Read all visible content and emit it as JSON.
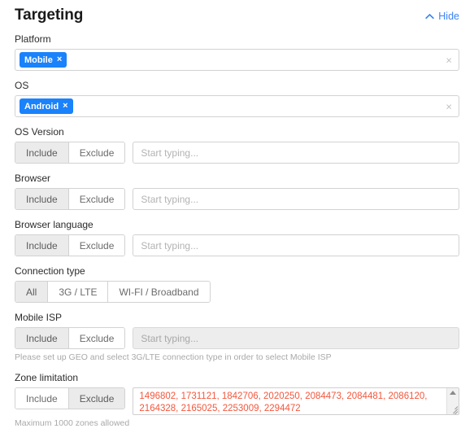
{
  "header": {
    "title": "Targeting",
    "hide_label": "Hide",
    "hide_icon": "chevron-up-icon",
    "accent_color": "#3b82f6"
  },
  "toggle_options": {
    "include": "Include",
    "exclude": "Exclude"
  },
  "placeholders": {
    "start_typing": "Start typing..."
  },
  "clear_icon": "×",
  "chip_remove_icon": "×",
  "colors": {
    "chip_bg": "#1a82fb",
    "zones_text": "#f4563c",
    "toggle_active_bg": "#ebebeb"
  },
  "fields": {
    "platform": {
      "label": "Platform",
      "chips": [
        {
          "label": "Mobile"
        }
      ],
      "has_clear": true
    },
    "os": {
      "label": "OS",
      "chips": [
        {
          "label": "Android"
        }
      ],
      "has_clear": true
    },
    "os_version": {
      "label": "OS Version",
      "selected": "Include",
      "value": "",
      "placeholder": "Start typing...",
      "disabled": false
    },
    "browser": {
      "label": "Browser",
      "selected": "Include",
      "value": "",
      "placeholder": "Start typing...",
      "disabled": false
    },
    "browser_language": {
      "label": "Browser language",
      "selected": "Include",
      "value": "",
      "placeholder": "Start typing...",
      "disabled": false
    },
    "connection_type": {
      "label": "Connection type",
      "options": [
        "All",
        "3G / LTE",
        "WI-FI / Broadband"
      ],
      "selected": "All"
    },
    "mobile_isp": {
      "label": "Mobile ISP",
      "selected": "Include",
      "value": "",
      "placeholder": "Start typing...",
      "disabled": true,
      "note": "Please set up GEO and select 3G/LTE connection type in order to select Mobile ISP"
    },
    "zone_limitation": {
      "label": "Zone limitation",
      "selected": "Exclude",
      "value": "1496802, 1731121, 1842706, 2020250, 2084473, 2084481, 2086120, 2164328, 2165025, 2253009, 2294472",
      "note": "Maximum 1000 zones allowed"
    }
  }
}
